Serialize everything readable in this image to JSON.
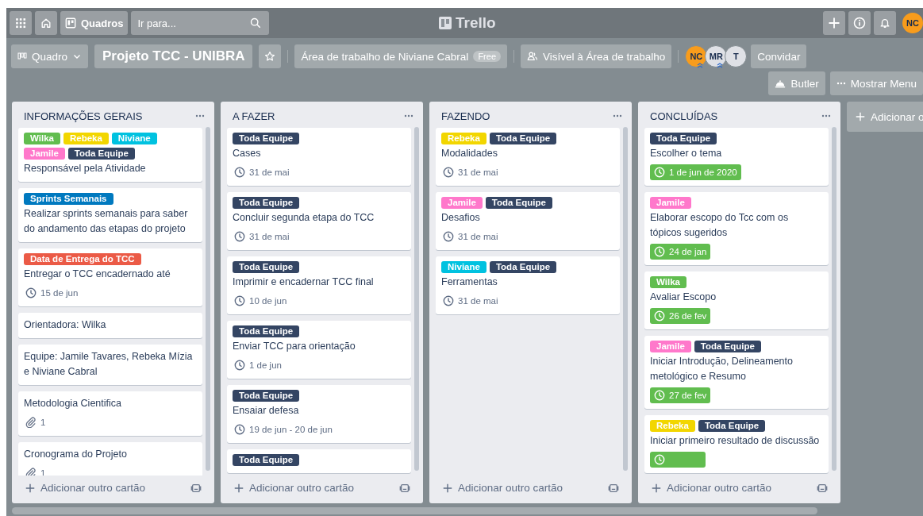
{
  "header": {
    "boards_button": "Quadros",
    "search": {
      "placeholder": "Ir para..."
    },
    "logo": "Trello",
    "user_initials": "NC"
  },
  "board_bar": {
    "view_button": "Quadro",
    "title": "Projeto TCC - UNIBRA",
    "starred": false,
    "workspace": "Área de trabalho de Niviane Cabral",
    "plan_badge": "Free",
    "visibility": "Visível à Área de trabalho",
    "members": [
      {
        "initials": "NC",
        "color": "#f89c1c",
        "admin": true
      },
      {
        "initials": "MR",
        "color": "#dfe1e6",
        "admin": true
      },
      {
        "initials": "T",
        "color": "#dfe1e6",
        "admin": false
      }
    ],
    "invite_button": "Convidar",
    "butler_button": "Butler",
    "menu_button": "Mostrar Menu"
  },
  "lists": [
    {
      "title": "INFORMAÇÕES GERAIS",
      "add_card": "Adicionar outro cartão",
      "cards": [
        {
          "labels": [
            {
              "text": "Wilka",
              "color": "#61bd4f"
            },
            {
              "text": "Rebeka",
              "color": "#f2d600"
            },
            {
              "text": "Niviane",
              "color": "#00c2e0"
            },
            {
              "text": "Jamile",
              "color": "#ff78cb"
            },
            {
              "text": "Toda Equipe",
              "color": "#344563"
            }
          ],
          "title": "Responsável pela Atividade"
        },
        {
          "labels": [
            {
              "text": "Sprints Semanais",
              "color": "#0079bf"
            }
          ],
          "title": "Realizar sprints semanais para saber do andamento das etapas do projeto"
        },
        {
          "labels": [
            {
              "text": "Data de Entrega do TCC",
              "color": "#eb5a46"
            }
          ],
          "title": "Entregar o TCC encadernado até",
          "due": {
            "text": "15 de jun",
            "complete": false
          }
        },
        {
          "title": "Orientadora: Wilka"
        },
        {
          "title": "Equipe: Jamile Tavares, Rebeka Mízia e Niviane Cabral"
        },
        {
          "title": "Metodologia Cientifica",
          "attachments": "1"
        },
        {
          "title": "Cronograma do Projeto",
          "attachments": "1"
        }
      ]
    },
    {
      "title": "A FAZER",
      "add_card": "Adicionar outro cartão",
      "cards": [
        {
          "labels": [
            {
              "text": "Toda Equipe",
              "color": "#344563"
            }
          ],
          "title": "Cases",
          "due": {
            "text": "31 de mai",
            "complete": false
          }
        },
        {
          "labels": [
            {
              "text": "Toda Equipe",
              "color": "#344563"
            }
          ],
          "title": "Concluir segunda etapa do TCC",
          "due": {
            "text": "31 de mai",
            "complete": false
          }
        },
        {
          "labels": [
            {
              "text": "Toda Equipe",
              "color": "#344563"
            }
          ],
          "title": "Imprimir e encadernar TCC final",
          "due": {
            "text": "10 de jun",
            "complete": false
          }
        },
        {
          "labels": [
            {
              "text": "Toda Equipe",
              "color": "#344563"
            }
          ],
          "title": "Enviar TCC para orientação",
          "due": {
            "text": "1 de jun",
            "complete": false
          }
        },
        {
          "labels": [
            {
              "text": "Toda Equipe",
              "color": "#344563"
            }
          ],
          "title": "Ensaiar defesa",
          "due": {
            "text": "19 de jun - 20 de jun",
            "complete": false
          }
        },
        {
          "labels": [
            {
              "text": "Toda Equipe",
              "color": "#344563"
            }
          ]
        }
      ]
    },
    {
      "title": "FAZENDO",
      "add_card": "Adicionar outro cartão",
      "cards": [
        {
          "labels": [
            {
              "text": "Rebeka",
              "color": "#f2d600"
            },
            {
              "text": "Toda Equipe",
              "color": "#344563"
            }
          ],
          "title": "Modalidades",
          "due": {
            "text": "31 de mai",
            "complete": false
          }
        },
        {
          "labels": [
            {
              "text": "Jamile",
              "color": "#ff78cb"
            },
            {
              "text": "Toda Equipe",
              "color": "#344563"
            }
          ],
          "title": "Desafios",
          "due": {
            "text": "31 de mai",
            "complete": false
          }
        },
        {
          "labels": [
            {
              "text": "Niviane",
              "color": "#00c2e0"
            },
            {
              "text": "Toda Equipe",
              "color": "#344563"
            }
          ],
          "title": "Ferramentas",
          "due": {
            "text": "31 de mai",
            "complete": false
          }
        }
      ]
    },
    {
      "title": "CONCLUÍDAS",
      "add_card": "Adicionar outro cartão",
      "cards": [
        {
          "labels": [
            {
              "text": "Toda Equipe",
              "color": "#344563"
            }
          ],
          "title": "Escolher o tema",
          "due": {
            "text": "1 de jun de 2020",
            "complete": true
          }
        },
        {
          "labels": [
            {
              "text": "Jamile",
              "color": "#ff78cb"
            }
          ],
          "title": "Elaborar escopo do Tcc com os tópicos sugeridos",
          "due": {
            "text": "24 de jan",
            "complete": true
          }
        },
        {
          "labels": [
            {
              "text": "Wilka",
              "color": "#61bd4f"
            }
          ],
          "title": "Avaliar Escopo",
          "due": {
            "text": "26 de fev",
            "complete": true
          }
        },
        {
          "labels": [
            {
              "text": "Jamile",
              "color": "#ff78cb"
            },
            {
              "text": "Toda Equipe",
              "color": "#344563"
            }
          ],
          "title": "Iniciar Introdução, Delineamento metológico e Resumo",
          "due": {
            "text": "27 de fev",
            "complete": true
          }
        },
        {
          "labels": [
            {
              "text": "Rebeka",
              "color": "#f2d600"
            },
            {
              "text": "Toda Equipe",
              "color": "#344563"
            }
          ],
          "title": "Iniciar primeiro resultado de discussão",
          "due": {
            "complete": true
          }
        }
      ]
    }
  ],
  "add_list": "Adicionar o"
}
